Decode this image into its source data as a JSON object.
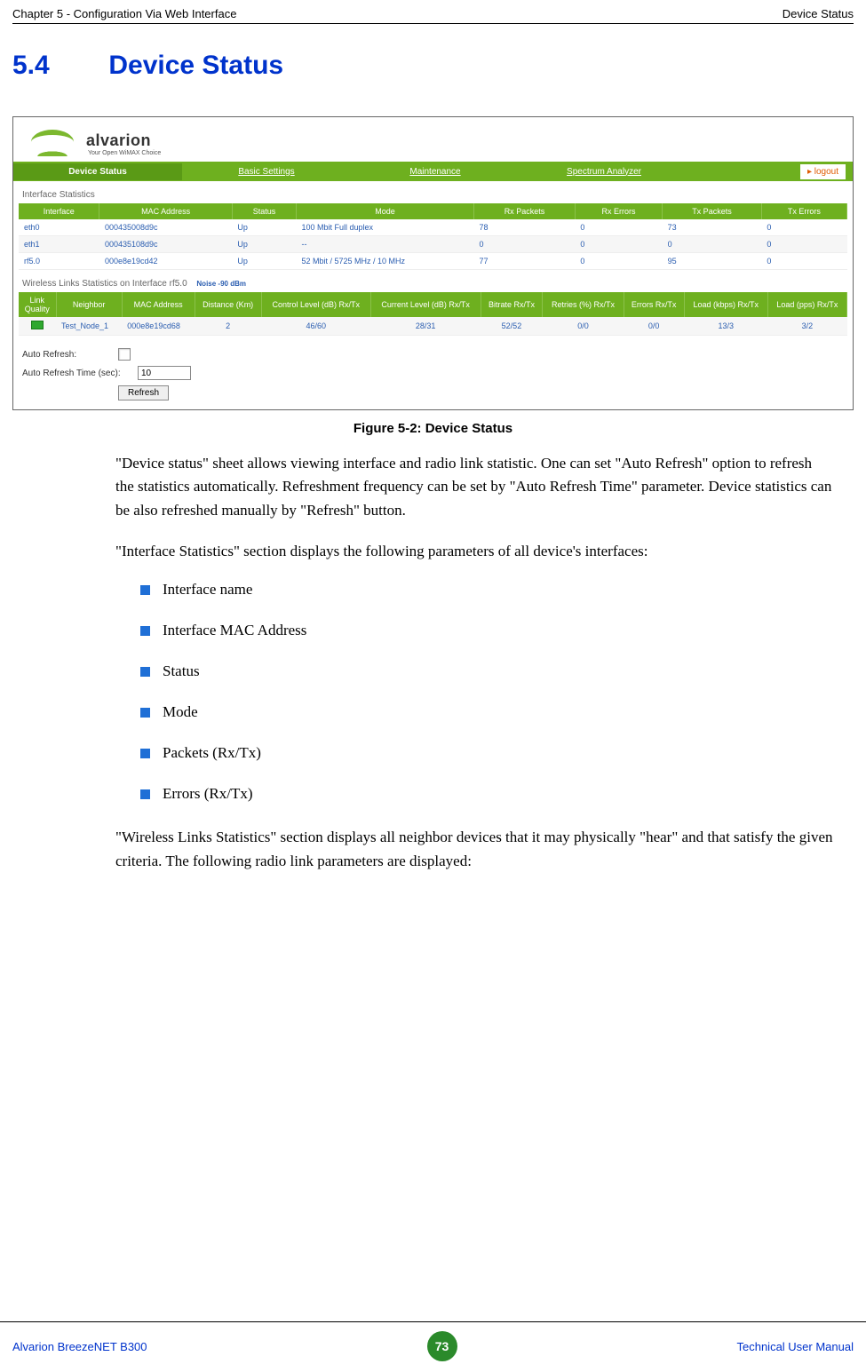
{
  "header": {
    "left": "Chapter 5 - Configuration Via Web Interface",
    "right": "Device Status"
  },
  "section": {
    "number": "5.4",
    "title": "Device Status"
  },
  "figure": {
    "logo_text": "alvarion",
    "logo_tag": "Your Open WiMAX Choice",
    "tabs": {
      "t0": "Device Status",
      "t1": "Basic Settings",
      "t2": "Maintenance",
      "t3": "Spectrum Analyzer"
    },
    "logout": "logout",
    "if_section": "Interface Statistics",
    "if_headers": {
      "c0": "Interface",
      "c1": "MAC Address",
      "c2": "Status",
      "c3": "Mode",
      "c4": "Rx Packets",
      "c5": "Rx Errors",
      "c6": "Tx Packets",
      "c7": "Tx Errors"
    },
    "if_rows": [
      {
        "c0": "eth0",
        "c1": "000435008d9c",
        "c2": "Up",
        "c3": "100 Mbit Full duplex",
        "c4": "78",
        "c5": "0",
        "c6": "73",
        "c7": "0"
      },
      {
        "c0": "eth1",
        "c1": "000435108d9c",
        "c2": "Up",
        "c3": "--",
        "c4": "0",
        "c5": "0",
        "c6": "0",
        "c7": "0"
      },
      {
        "c0": "rf5.0",
        "c1": "000e8e19cd42",
        "c2": "Up",
        "c3": "52 Mbit / 5725 MHz / 10 MHz",
        "c4": "77",
        "c5": "0",
        "c6": "95",
        "c7": "0"
      }
    ],
    "wl_section": "Wireless Links Statistics on Interface rf5.0",
    "noise": "Noise -90 dBm",
    "wl_headers": {
      "c0": "Link Quality",
      "c1": "Neighbor",
      "c2": "MAC Address",
      "c3": "Distance (Km)",
      "c4": "Control Level (dB) Rx/Tx",
      "c5": "Current Level (dB) Rx/Tx",
      "c6": "Bitrate Rx/Tx",
      "c7": "Retries (%) Rx/Tx",
      "c8": "Errors Rx/Tx",
      "c9": "Load (kbps) Rx/Tx",
      "c10": "Load (pps) Rx/Tx"
    },
    "wl_rows": [
      {
        "c1": "Test_Node_1",
        "c2": "000e8e19cd68",
        "c3": "2",
        "c4": "46/60",
        "c5": "28/31",
        "c6": "52/52",
        "c7": "0/0",
        "c8": "0/0",
        "c9": "13/3",
        "c10": "3/2"
      }
    ],
    "controls": {
      "auto_refresh": "Auto Refresh:",
      "auto_time": "Auto Refresh Time (sec):",
      "time_val": "10",
      "refresh_btn": "Refresh"
    }
  },
  "caption": "Figure 5-2: Device Status",
  "para1": "\"Device status\" sheet allows viewing interface and radio link statistic. One can set \"Auto Refresh\" option to refresh the statistics automatically. Refreshment frequency can be set by \"Auto Refresh Time\" parameter. Device statistics can be also refreshed manually by \"Refresh\" button.",
  "para2": "\"Interface Statistics\" section displays the following parameters of all device's interfaces:",
  "bullets": {
    "b0": "Interface name",
    "b1": "Interface MAC Address",
    "b2": "Status",
    "b3": "Mode",
    "b4": "Packets (Rx/Tx)",
    "b5": "Errors (Rx/Tx)"
  },
  "para3": "\"Wireless Links Statistics\" section displays all neighbor devices that it may physically \"hear\" and that satisfy the given criteria. The following radio link parameters are displayed:",
  "footer": {
    "left": "Alvarion BreezeNET B300",
    "page": "73",
    "right": "Technical User Manual"
  }
}
